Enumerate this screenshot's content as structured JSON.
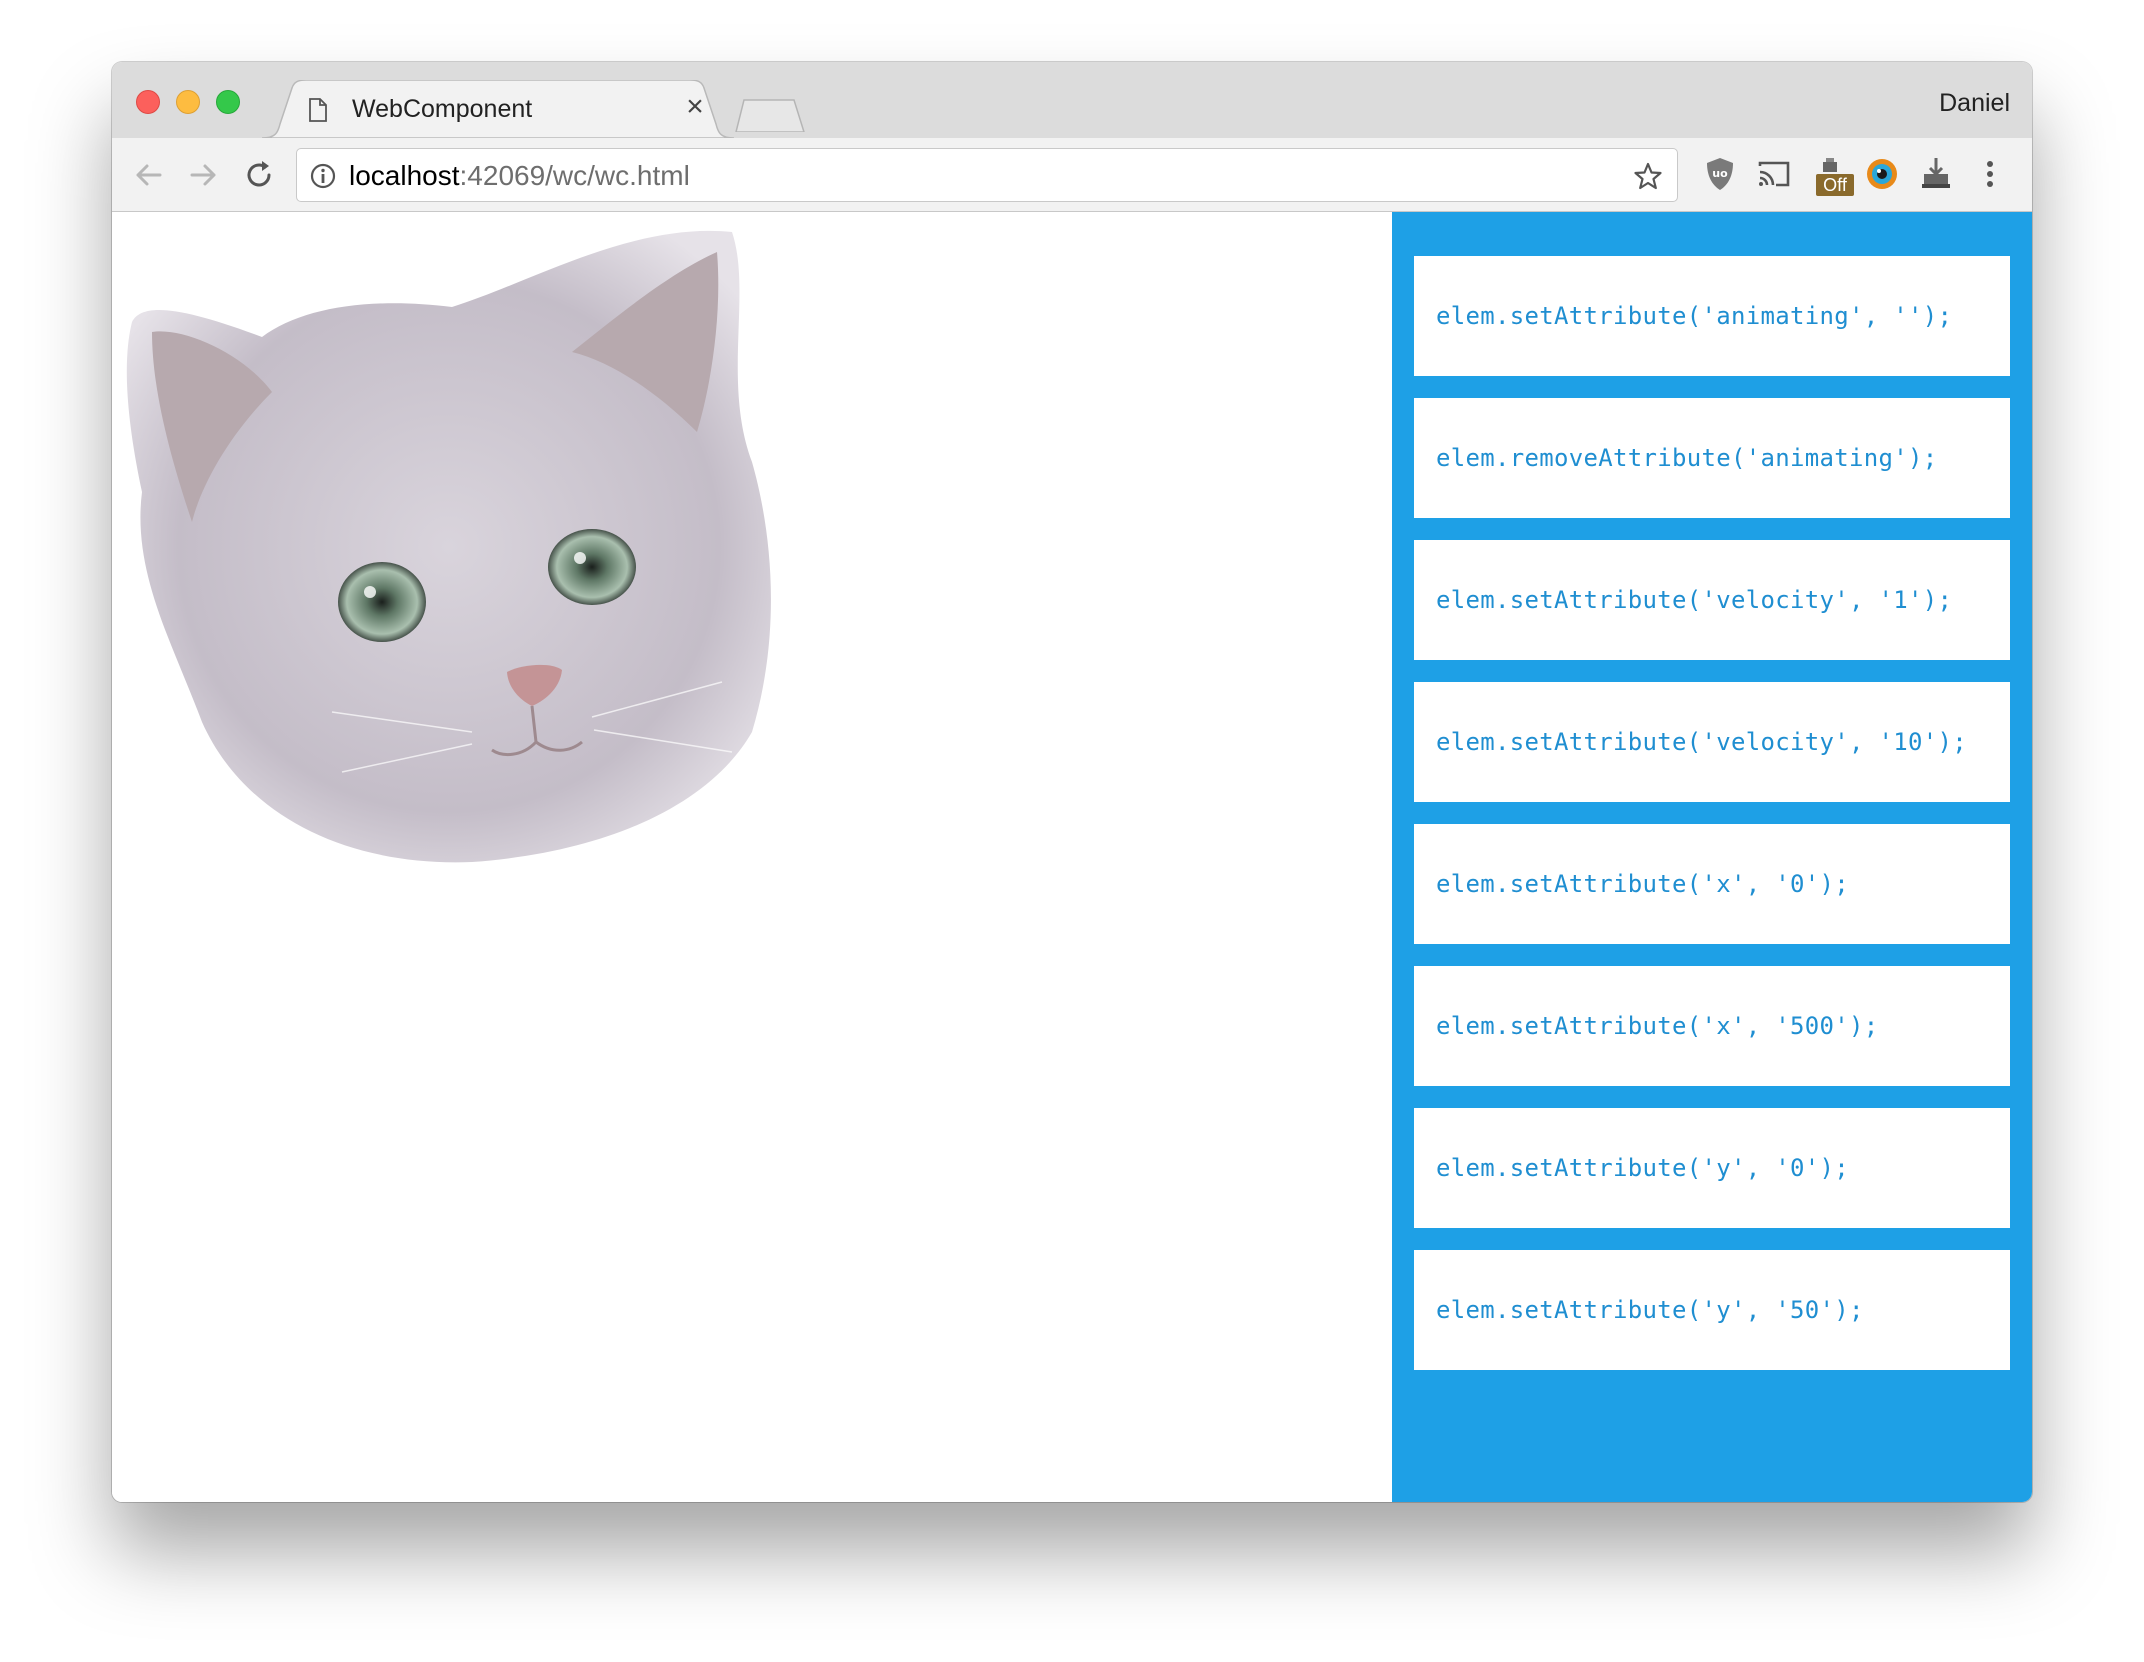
{
  "browser": {
    "tab_title": "WebComponent",
    "profile_name": "Daniel",
    "url_host": "localhost",
    "url_path": ":42069/wc/wc.html",
    "extensions": {
      "off_badge": "Off"
    }
  },
  "page": {
    "image": "kitten-face",
    "panel_color": "#1ea0e6",
    "commands": [
      "elem.setAttribute('animating', '');",
      "elem.removeAttribute('animating');",
      "elem.setAttribute('velocity', '1');",
      "elem.setAttribute('velocity', '10');",
      "elem.setAttribute('x', '0');",
      "elem.setAttribute('x', '500');",
      "elem.setAttribute('y', '0');",
      "elem.setAttribute('y', '50');"
    ]
  }
}
